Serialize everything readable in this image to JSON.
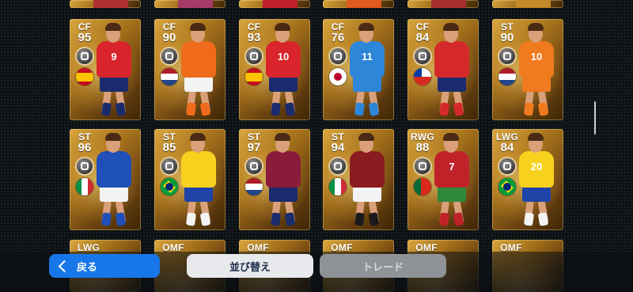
{
  "top_row": [
    {
      "jersey_color": "#b03030"
    },
    {
      "jersey_color": "#a83a6a"
    },
    {
      "jersey_color": "#c01e2a"
    },
    {
      "jersey_color": "#e05a20"
    },
    {
      "jersey_color": "#a83030"
    },
    {
      "jersey_color": "#c28a2a"
    }
  ],
  "cards": [
    {
      "position": "CF",
      "rating": "95",
      "flag": "spain",
      "number": "9",
      "jersey": "#d8242a",
      "shorts": "#1b2b6e",
      "socks": "#1b2b6e"
    },
    {
      "position": "CF",
      "rating": "90",
      "flag": "netherlands",
      "number": "",
      "jersey": "#ef6a1a",
      "shorts": "#f3f3f3",
      "socks": "#ef6a1a"
    },
    {
      "position": "CF",
      "rating": "93",
      "flag": "spain",
      "number": "10",
      "jersey": "#d8242a",
      "shorts": "#1b2b6e",
      "socks": "#1b2b6e"
    },
    {
      "position": "CF",
      "rating": "76",
      "flag": "japan",
      "number": "11",
      "jersey": "#2e86d8",
      "shorts": "#2e86d8",
      "socks": "#2e86d8"
    },
    {
      "position": "CF",
      "rating": "84",
      "flag": "chile",
      "number": "",
      "jersey": "#d62a2a",
      "shorts": "#1b2b6e",
      "socks": "#d62a2a"
    },
    {
      "position": "ST",
      "rating": "90",
      "flag": "netherlands",
      "number": "10",
      "jersey": "#f07a1e",
      "shorts": "#f07a1e",
      "socks": "#f07a1e"
    },
    {
      "position": "ST",
      "rating": "96",
      "flag": "italy",
      "number": "",
      "jersey": "#1f4fb8",
      "shorts": "#f3f3f3",
      "socks": "#1f4fb8"
    },
    {
      "position": "ST",
      "rating": "85",
      "flag": "brazil",
      "number": "",
      "jersey": "#f6d21e",
      "shorts": "#1f44a8",
      "socks": "#f3f3f3"
    },
    {
      "position": "ST",
      "rating": "97",
      "flag": "netherlands",
      "number": "",
      "jersey": "#8a1b3a",
      "shorts": "#1b2b6e",
      "socks": "#1b2b6e"
    },
    {
      "position": "ST",
      "rating": "94",
      "flag": "italy",
      "number": "",
      "jersey": "#8a1b1e",
      "shorts": "#f3f3f3",
      "socks": "#1b1b1b"
    },
    {
      "position": "RWG",
      "rating": "88",
      "flag": "portugal",
      "number": "7",
      "jersey": "#c0222a",
      "shorts": "#2e8a3a",
      "socks": "#c0222a"
    },
    {
      "position": "LWG",
      "rating": "84",
      "flag": "brazil",
      "number": "20",
      "jersey": "#f6d21e",
      "shorts": "#1f44a8",
      "socks": "#f3f3f3"
    }
  ],
  "bottom_row": [
    {
      "position": "LWG"
    },
    {
      "position": "OMF"
    },
    {
      "position": "OMF"
    },
    {
      "position": "OMF"
    },
    {
      "position": "OMF"
    },
    {
      "position": "OMF"
    }
  ],
  "buttons": {
    "back": "戻る",
    "sort": "並び替え",
    "trade": "トレード"
  }
}
